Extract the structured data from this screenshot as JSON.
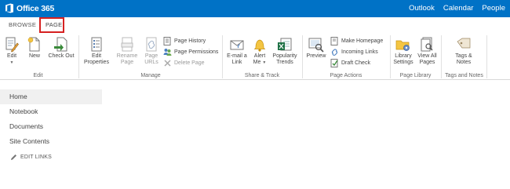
{
  "suite": {
    "app_name": "Office 365",
    "links": [
      "Outlook",
      "Calendar",
      "People"
    ]
  },
  "tabs": {
    "browse": "BROWSE",
    "page": "PAGE"
  },
  "ribbon": {
    "edit_group": {
      "label": "Edit",
      "edit": "Edit",
      "new": "New",
      "check_out": "Check Out"
    },
    "manage_group": {
      "label": "Manage",
      "edit_properties": "Edit Properties",
      "rename_page": "Rename Page",
      "page_urls": "Page URLs",
      "page_history": "Page History",
      "page_permissions": "Page Permissions",
      "delete_page": "Delete Page"
    },
    "share_group": {
      "label": "Share & Track",
      "email_link": "E-mail a Link",
      "alert_me": "Alert Me",
      "popularity_trends": "Popularity Trends"
    },
    "actions_group": {
      "label": "Page Actions",
      "preview": "Preview",
      "make_homepage": "Make Homepage",
      "incoming_links": "Incoming Links",
      "draft_check": "Draft Check"
    },
    "library_group": {
      "label": "Page Library",
      "library_settings": "Library Settings",
      "view_all_pages": "View All Pages"
    },
    "tags_group": {
      "label": "Tags and Notes",
      "tags_notes": "Tags & Notes"
    }
  },
  "nav": {
    "items": [
      "Home",
      "Notebook",
      "Documents",
      "Site Contents"
    ],
    "edit_links": "EDIT LINKS"
  },
  "colors": {
    "suite_bar": "#0072c6",
    "highlight": "#d62121"
  }
}
